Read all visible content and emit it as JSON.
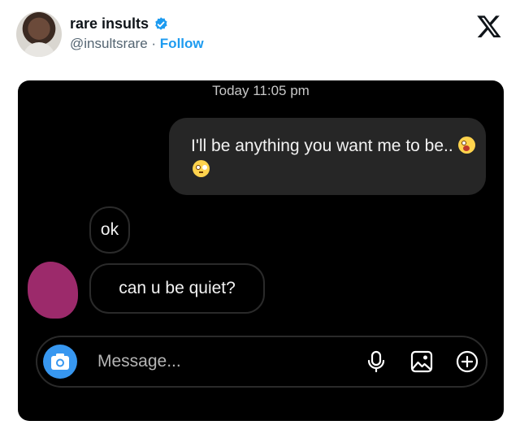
{
  "post": {
    "author_name": "rare insults",
    "handle": "@insultsrare",
    "separator": " · ",
    "follow_label": "Follow"
  },
  "chat": {
    "timestamp": "Today 11:05 pm",
    "messages": [
      {
        "direction": "outgoing",
        "text": "I'll be anything you want me to be..",
        "emojis": [
          "astonished-face",
          "flushed-face"
        ]
      },
      {
        "direction": "incoming",
        "text": "ok"
      },
      {
        "direction": "incoming",
        "text": "can u be quiet?"
      }
    ],
    "composer": {
      "placeholder": "Message...",
      "icons": [
        "camera-icon",
        "microphone-icon",
        "gallery-icon",
        "plus-icon"
      ]
    }
  },
  "colors": {
    "chat_background": "#000000",
    "outgoing_bubble": "#262626",
    "camera_button": "#3797f0",
    "follow_link": "#1d9bf0",
    "verified_badge": "#1d9bf0",
    "redacted_avatar": "#9c2a6b"
  }
}
